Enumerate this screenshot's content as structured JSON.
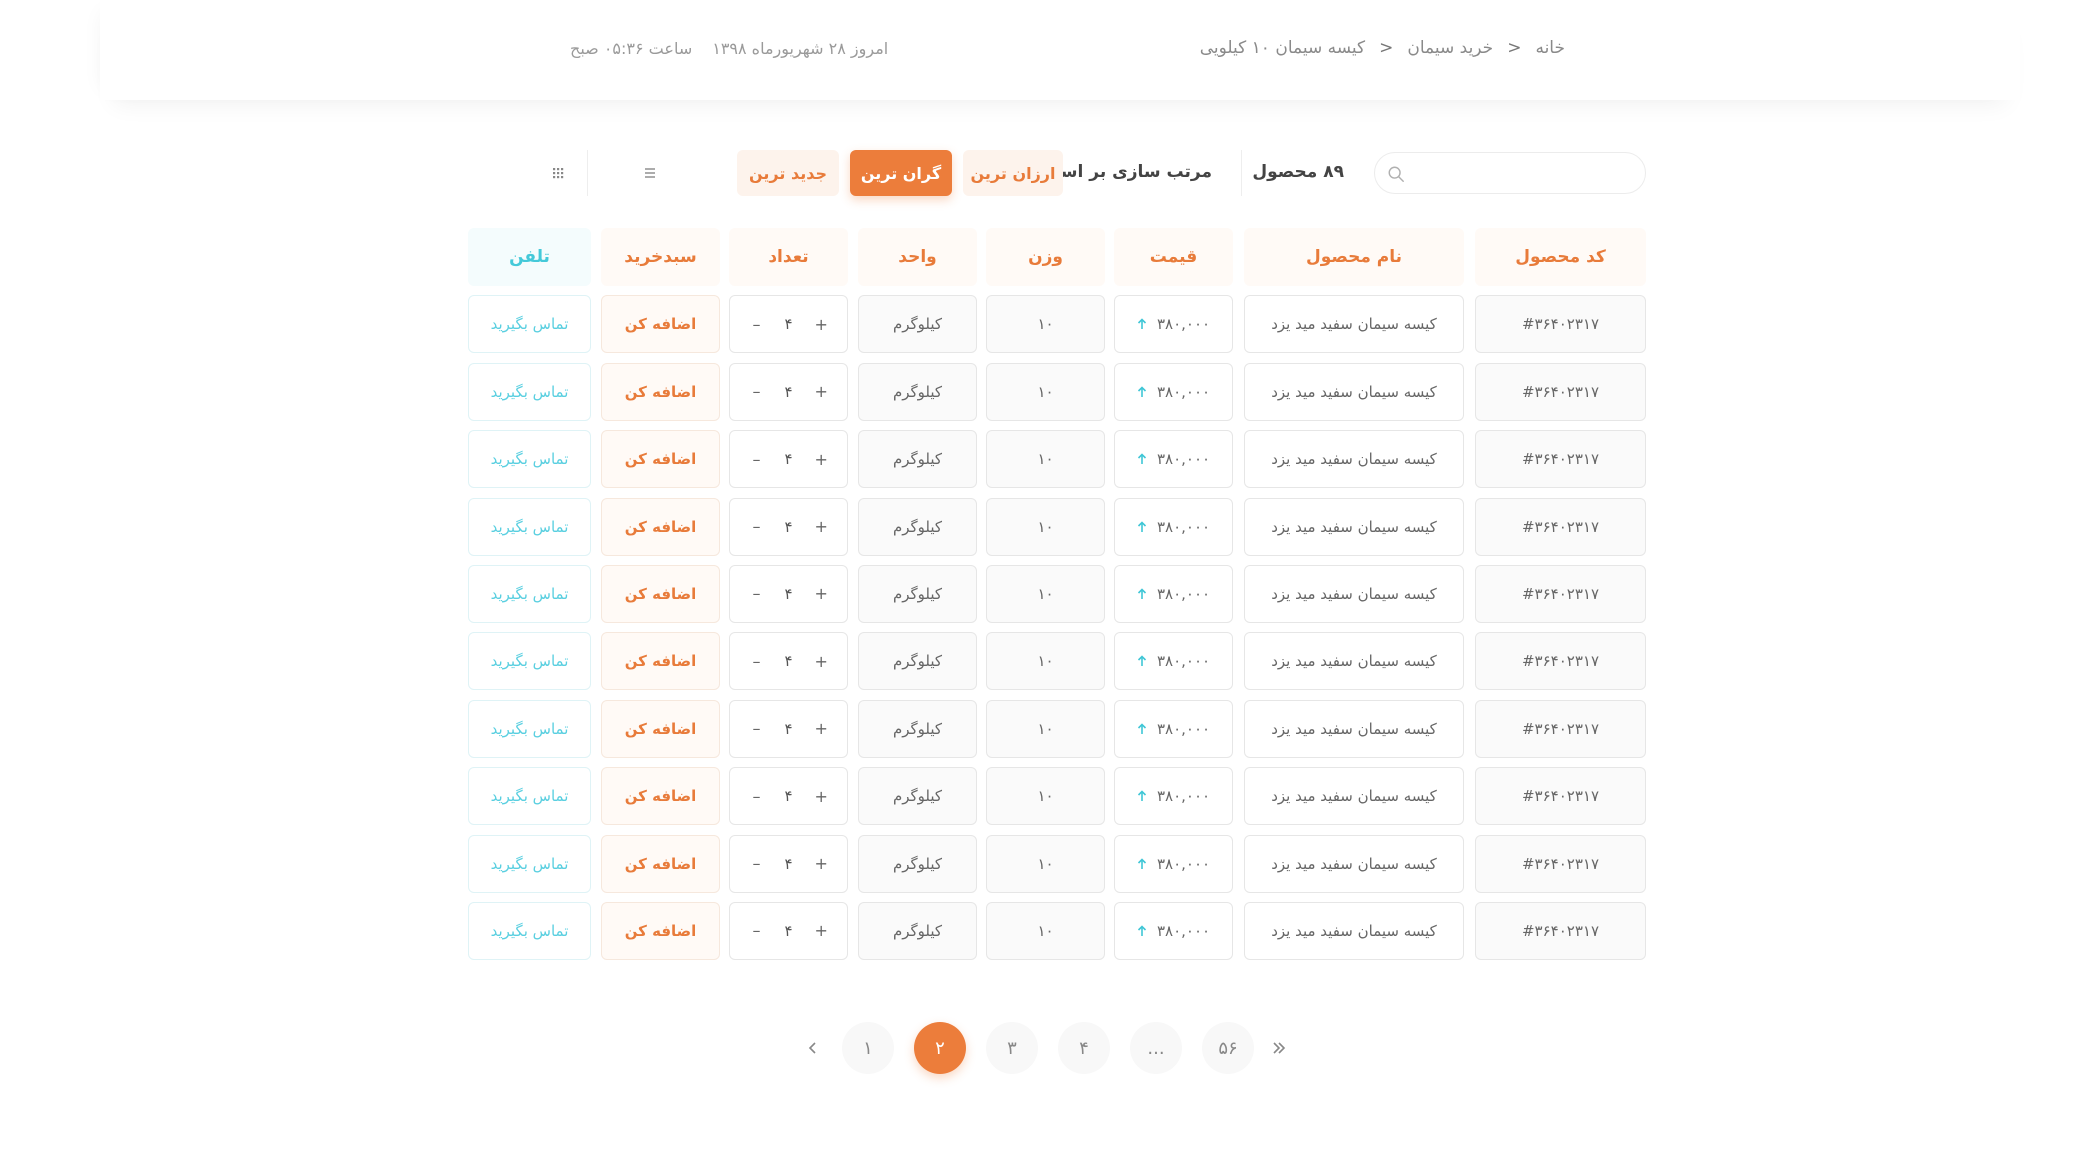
{
  "header": {
    "breadcrumb": [
      "خانه",
      "خرید سیمان",
      "کیسه سیمان ۱۰ کیلویی"
    ],
    "breadcrumb_sep": ">",
    "date": "امروز ۲۸ شهریورماه ۱۳۹۸",
    "time": "ساعت ۰۵:۳۶ صبح"
  },
  "toolbar": {
    "search_placeholder": "",
    "product_count": "۸۹ محصول",
    "sort_label": "مرتب سازی بر اساس",
    "sort_options": [
      "ارزان ترین",
      "گران ترین",
      "جدید ترین"
    ],
    "active_sort": "گران ترین"
  },
  "table": {
    "headers": {
      "code": "کد محصول",
      "name": "نام محصول",
      "price": "قیمت",
      "weight": "وزن",
      "unit": "واحد",
      "qty": "تعداد",
      "cart": "سبدخرید",
      "phone": "تلفن"
    },
    "rows": [
      {
        "code": "#۳۶۴۰۲۳۱۷",
        "name": "کیسه سیمان سفید مید یزد",
        "price": "۳۸۰,۰۰۰",
        "weight": "۱۰",
        "unit": "کیلوگرم",
        "qty": "۴",
        "cart": "اضافه کن",
        "phone": "تماس بگیرید"
      },
      {
        "code": "#۳۶۴۰۲۳۱۷",
        "name": "کیسه سیمان سفید مید یزد",
        "price": "۳۸۰,۰۰۰",
        "weight": "۱۰",
        "unit": "کیلوگرم",
        "qty": "۴",
        "cart": "اضافه کن",
        "phone": "تماس بگیرید"
      },
      {
        "code": "#۳۶۴۰۲۳۱۷",
        "name": "کیسه سیمان سفید مید یزد",
        "price": "۳۸۰,۰۰۰",
        "weight": "۱۰",
        "unit": "کیلوگرم",
        "qty": "۴",
        "cart": "اضافه کن",
        "phone": "تماس بگیرید"
      },
      {
        "code": "#۳۶۴۰۲۳۱۷",
        "name": "کیسه سیمان سفید مید یزد",
        "price": "۳۸۰,۰۰۰",
        "weight": "۱۰",
        "unit": "کیلوگرم",
        "qty": "۴",
        "cart": "اضافه کن",
        "phone": "تماس بگیرید"
      },
      {
        "code": "#۳۶۴۰۲۳۱۷",
        "name": "کیسه سیمان سفید مید یزد",
        "price": "۳۸۰,۰۰۰",
        "weight": "۱۰",
        "unit": "کیلوگرم",
        "qty": "۴",
        "cart": "اضافه کن",
        "phone": "تماس بگیرید"
      },
      {
        "code": "#۳۶۴۰۲۳۱۷",
        "name": "کیسه سیمان سفید مید یزد",
        "price": "۳۸۰,۰۰۰",
        "weight": "۱۰",
        "unit": "کیلوگرم",
        "qty": "۴",
        "cart": "اضافه کن",
        "phone": "تماس بگیرید"
      },
      {
        "code": "#۳۶۴۰۲۳۱۷",
        "name": "کیسه سیمان سفید مید یزد",
        "price": "۳۸۰,۰۰۰",
        "weight": "۱۰",
        "unit": "کیلوگرم",
        "qty": "۴",
        "cart": "اضافه کن",
        "phone": "تماس بگیرید"
      },
      {
        "code": "#۳۶۴۰۲۳۱۷",
        "name": "کیسه سیمان سفید مید یزد",
        "price": "۳۸۰,۰۰۰",
        "weight": "۱۰",
        "unit": "کیلوگرم",
        "qty": "۴",
        "cart": "اضافه کن",
        "phone": "تماس بگیرید"
      },
      {
        "code": "#۳۶۴۰۲۳۱۷",
        "name": "کیسه سیمان سفید مید یزد",
        "price": "۳۸۰,۰۰۰",
        "weight": "۱۰",
        "unit": "کیلوگرم",
        "qty": "۴",
        "cart": "اضافه کن",
        "phone": "تماس بگیرید"
      },
      {
        "code": "#۳۶۴۰۲۳۱۷",
        "name": "کیسه سیمان سفید مید یزد",
        "price": "۳۸۰,۰۰۰",
        "weight": "۱۰",
        "unit": "کیلوگرم",
        "qty": "۴",
        "cart": "اضافه کن",
        "phone": "تماس بگیرید"
      }
    ],
    "qty_plus": "+",
    "qty_minus": "–"
  },
  "pagination": {
    "pages": [
      "۱",
      "۲",
      "۳",
      "۴",
      "...",
      "۵۶"
    ],
    "current": "۲"
  },
  "icons": {
    "search": "search-icon",
    "list_view": "list-view-icon",
    "grid_view": "grid-view-icon",
    "price_up": "arrow-up-icon",
    "prev": "chevron-left-icon",
    "last": "double-chevron-right-icon"
  },
  "colors": {
    "accent": "#ec7d3b",
    "accent_soft": "#fdf3ec",
    "phone": "#59cfe0",
    "price_arrow": "#3fc6d6"
  }
}
